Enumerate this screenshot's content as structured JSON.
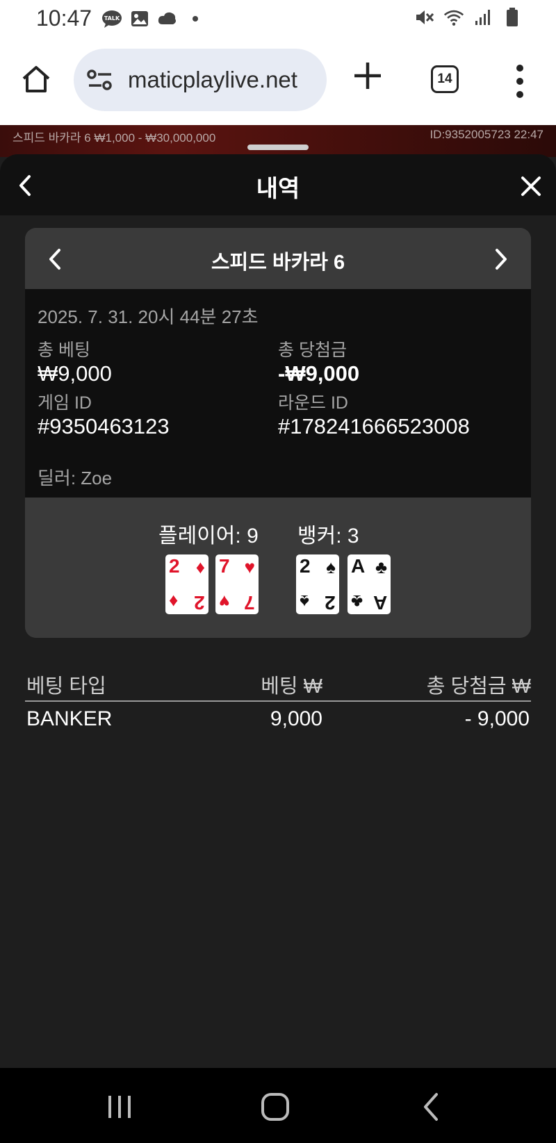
{
  "status_bar": {
    "time": "10:47",
    "left_icons": [
      "talk-icon",
      "gallery-icon",
      "cloud-icon",
      "dot-icon"
    ],
    "right_icons": [
      "mute-icon",
      "wifi-icon",
      "signal-icon",
      "battery-icon"
    ],
    "talk_badge": "TALK"
  },
  "browser": {
    "url": "maticplaylive.net",
    "tab_count": "14"
  },
  "game_strip": {
    "left_text": "스피드 바카라 6  ₩1,000 - ₩30,000,000",
    "right_text": "ID:9352005723  22:47"
  },
  "sheet": {
    "title": "내역",
    "card": {
      "title": "스피드 바카라 6",
      "date": "2025. 7. 31. 20시 44분 27초",
      "total_bet_label": "총 베팅",
      "total_bet_value": "₩9,000",
      "total_win_label": "총 당첨금",
      "total_win_value": "-₩9,000",
      "game_id_label": "게임 ID",
      "game_id_value": "#9350463123",
      "round_id_label": "라운드 ID",
      "round_id_value": "#178241666523008",
      "dealer": "딜러: Zoe",
      "player_label": "플레이어: 9",
      "banker_label": "뱅커: 3",
      "player_cards": [
        {
          "rank": "2",
          "suit": "♦",
          "color": "#e0142a"
        },
        {
          "rank": "7",
          "suit": "♥",
          "color": "#e0142a"
        }
      ],
      "banker_cards": [
        {
          "rank": "2",
          "suit": "♠",
          "color": "#111111"
        },
        {
          "rank": "A",
          "suit": "♣",
          "color": "#111111"
        }
      ]
    },
    "table": {
      "headers": [
        "베팅 타입",
        "베팅 ₩",
        "총 당첨금 ₩"
      ],
      "rows": [
        [
          "BANKER",
          "9,000",
          "- 9,000"
        ]
      ]
    }
  },
  "nav_bar": {
    "icons": [
      "recent-apps-icon",
      "home-icon",
      "back-icon"
    ]
  }
}
